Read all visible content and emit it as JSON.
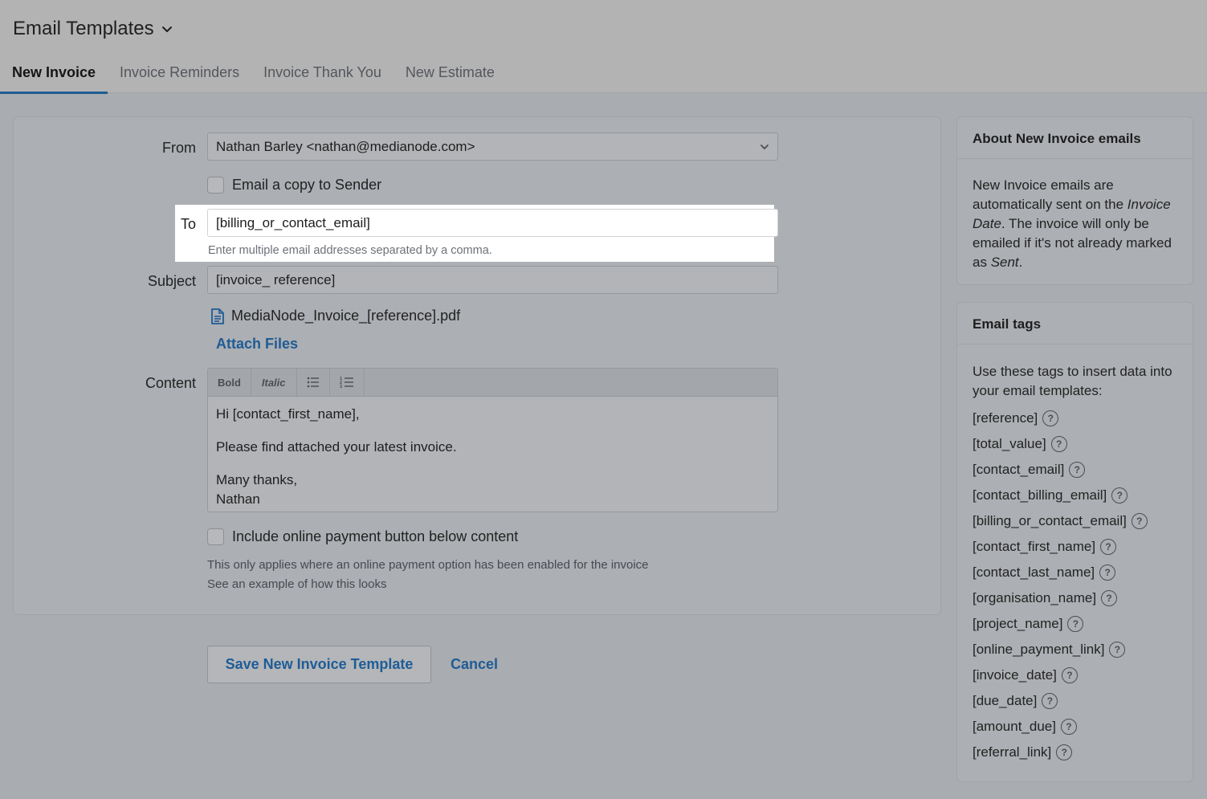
{
  "header": {
    "title": "Email Templates",
    "tabs": [
      {
        "label": "New Invoice",
        "active": true
      },
      {
        "label": "Invoice Reminders",
        "active": false
      },
      {
        "label": "Invoice Thank You",
        "active": false
      },
      {
        "label": "New Estimate",
        "active": false
      }
    ]
  },
  "form": {
    "from_label": "From",
    "from_value": "Nathan Barley <nathan@medianode.com>",
    "copy_sender_label": "Email a copy to Sender",
    "to_label": "To",
    "to_value": "[billing_or_contact_email]",
    "to_hint": "Enter multiple email addresses separated by a comma.",
    "subject_label": "Subject",
    "subject_value": "[invoice_ reference]",
    "attachment_name": "MediaNode_Invoice_[reference].pdf",
    "attach_files_label": "Attach Files",
    "content_label": "Content",
    "toolbar": {
      "bold": "Bold",
      "italic": "Italic"
    },
    "content_lines": {
      "greeting": "Hi [contact_first_name],",
      "body": "Please find attached your latest invoice.",
      "signoff": "Many thanks,",
      "name": "Nathan"
    },
    "payment_button_label": "Include online payment button below content",
    "payment_note": "This only applies where an online payment option has been enabled for the invoice",
    "example_link": "See an example of how this looks"
  },
  "actions": {
    "save_label": "Save New Invoice Template",
    "cancel_label": "Cancel"
  },
  "about": {
    "title": "About New Invoice emails",
    "text_1": "New Invoice emails are automatically sent on the ",
    "emph_1": "Invoice Date",
    "text_2": ". The invoice will only be emailed if it's not already marked as ",
    "emph_2": "Sent",
    "text_3": "."
  },
  "tags": {
    "title": "Email tags",
    "intro": "Use these tags to insert data into your email templates:",
    "items": [
      "[reference]",
      "[total_value]",
      "[contact_email]",
      "[contact_billing_email]",
      "[billing_or_contact_email]",
      "[contact_first_name]",
      "[contact_last_name]",
      "[organisation_name]",
      "[project_name]",
      "[online_payment_link]",
      "[invoice_date]",
      "[due_date]",
      "[amount_due]",
      "[referral_link]"
    ],
    "help_glyph": "?"
  },
  "colors": {
    "accent": "#1f5d93",
    "link": "#1f5c96",
    "overlay_bg": "#a9acb0",
    "highlight": "#ffffff"
  },
  "icons": [
    "chevron-down-icon",
    "document-icon",
    "bullet-list-icon",
    "numbered-list-icon",
    "help-circle-icon"
  ]
}
